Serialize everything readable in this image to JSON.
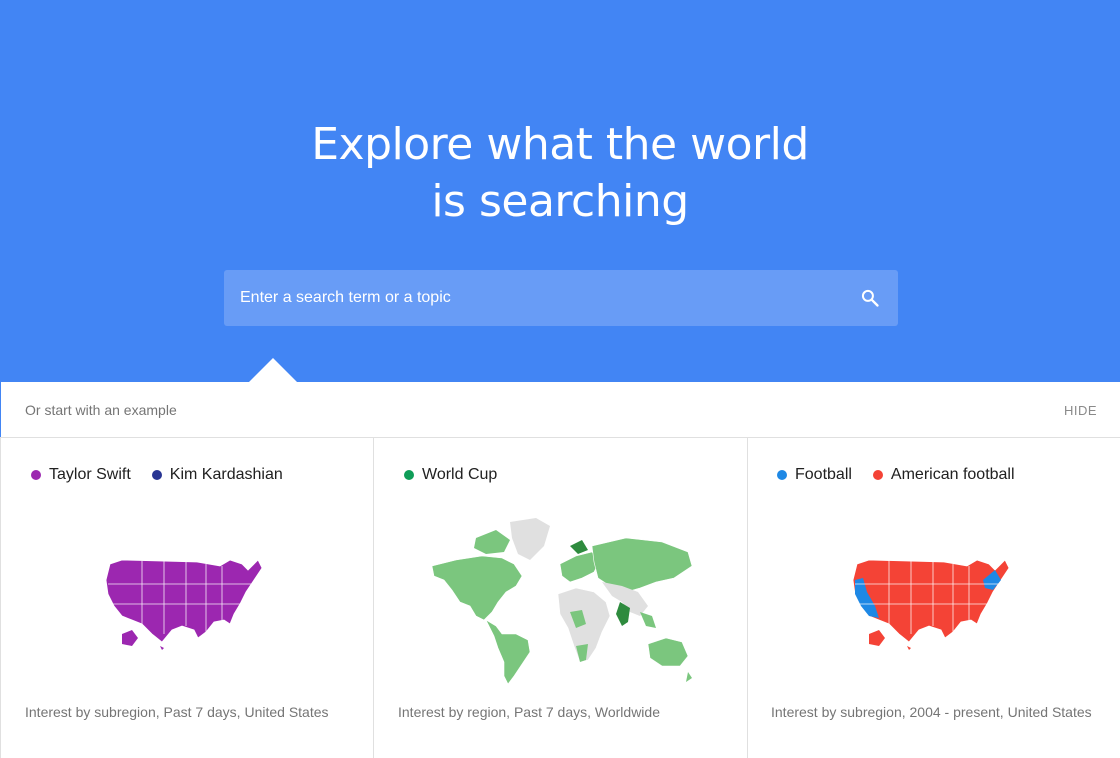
{
  "hero": {
    "title_line1": "Explore what the world",
    "title_line2": "is searching",
    "background": "#4285f4"
  },
  "search": {
    "placeholder": "Enter a search term or a topic",
    "value": "",
    "icon": "search-icon"
  },
  "examples": {
    "label": "Or start with an example",
    "hide_label": "HIDE",
    "cards": [
      {
        "legend": [
          {
            "label": "Taylor Swift",
            "color": "#9c27b0"
          },
          {
            "label": "Kim Kardashian",
            "color": "#283593"
          }
        ],
        "map": "united-states-map",
        "map_color": "#9c27b0",
        "caption": "Interest by subregion, Past 7 days, United States"
      },
      {
        "legend": [
          {
            "label": "World Cup",
            "color": "#0f9d58"
          }
        ],
        "map": "world-map",
        "map_color": "#7bc67e",
        "caption": "Interest by region, Past 7 days, Worldwide"
      },
      {
        "legend": [
          {
            "label": "Football",
            "color": "#1e88e5"
          },
          {
            "label": "American football",
            "color": "#f44336"
          }
        ],
        "map": "united-states-map",
        "map_color": "#f44336",
        "caption": "Interest by subregion, 2004 - present, United States"
      }
    ]
  }
}
